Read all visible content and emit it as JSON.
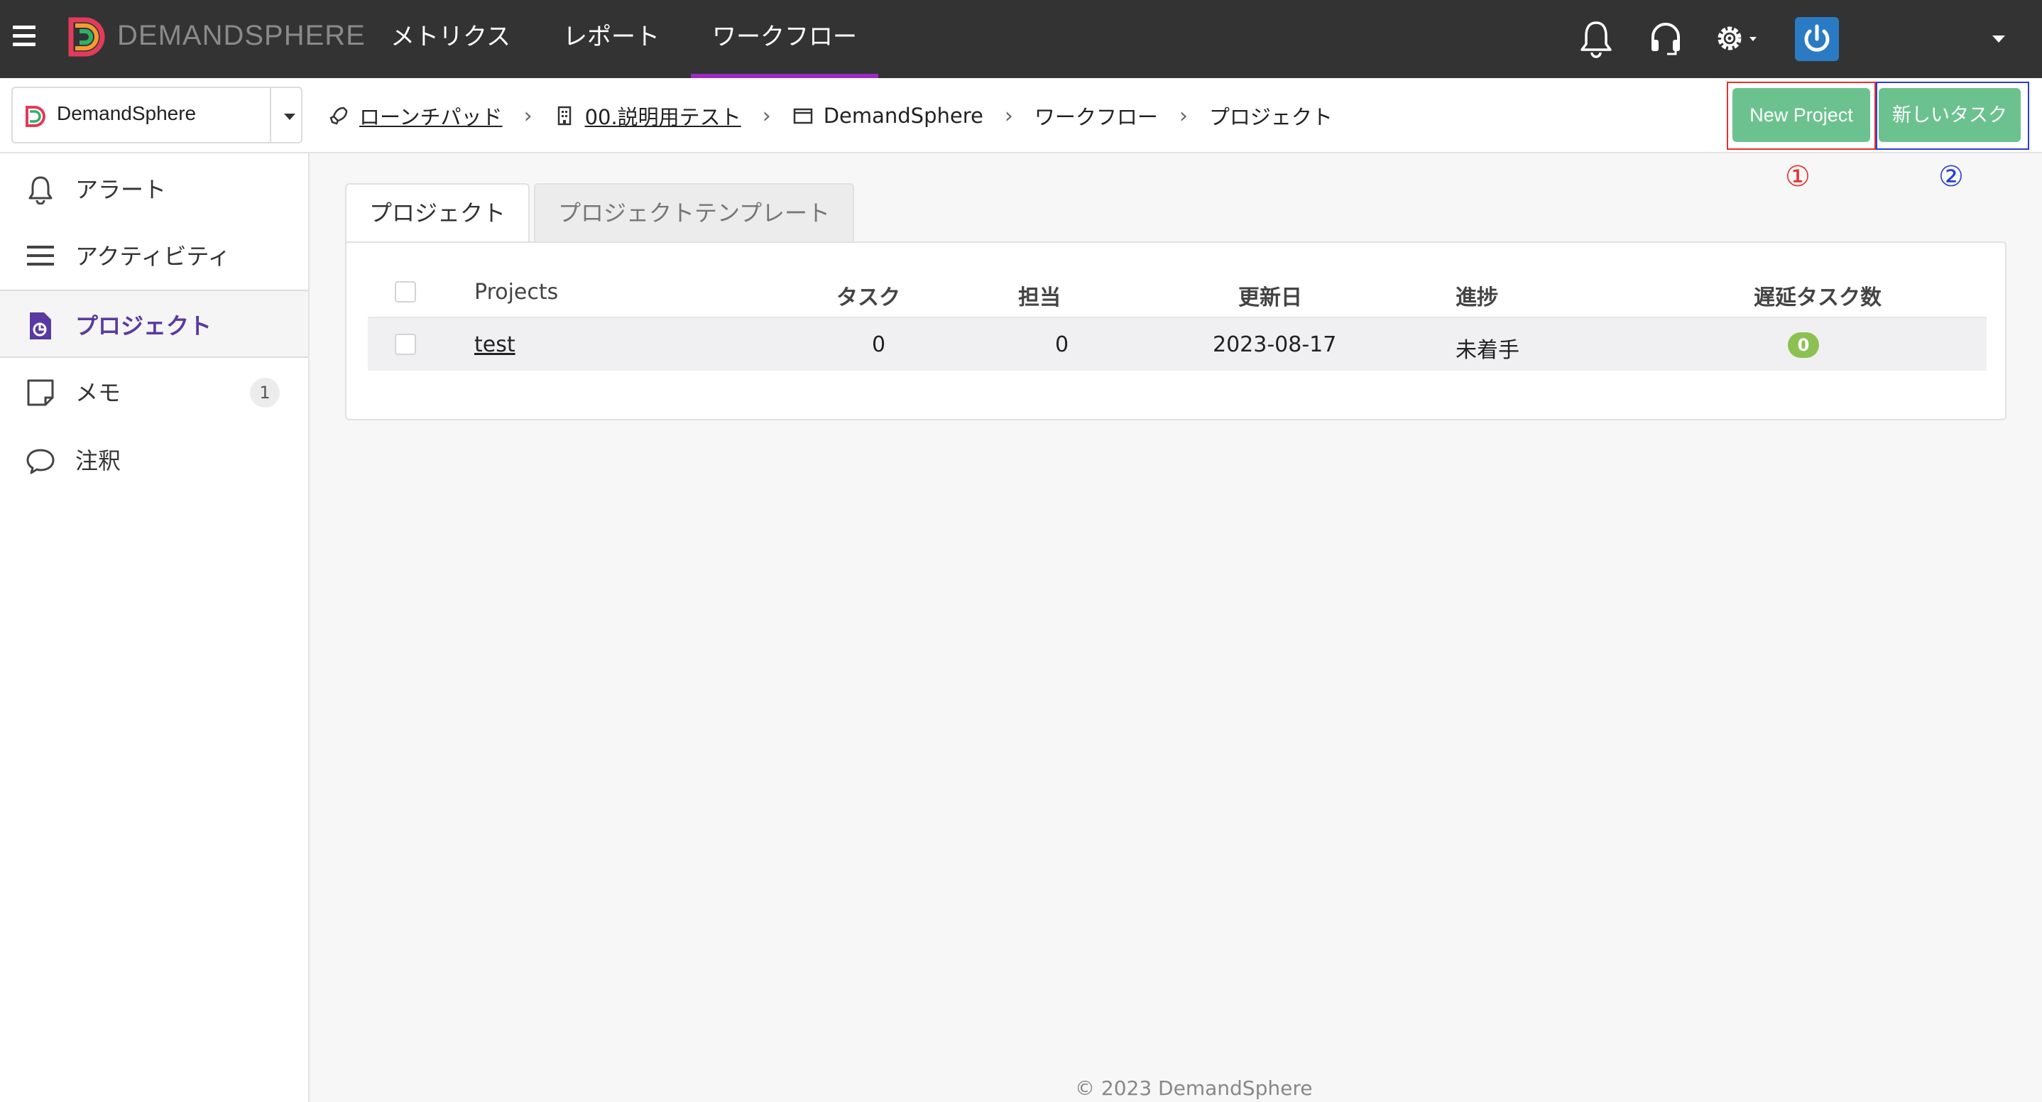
{
  "header": {
    "brand": "DEMANDSPHERE",
    "nav": [
      {
        "label": "メトリクス"
      },
      {
        "label": "レポート"
      },
      {
        "label": "ワークフロー",
        "active": true
      }
    ],
    "icons": [
      "menu-icon",
      "bell-icon",
      "headset-icon",
      "gear-icon",
      "power-icon",
      "chevron-down-icon"
    ]
  },
  "site_selector": {
    "name": "DemandSphere"
  },
  "breadcrumb": [
    {
      "label": "ローンチパッド",
      "icon": "rocket-icon",
      "link": true
    },
    {
      "label": "00.説明用テスト",
      "icon": "building-icon",
      "link": true
    },
    {
      "label": "DemandSphere",
      "icon": "window-icon",
      "link": false
    },
    {
      "label": "ワークフロー",
      "link": false
    },
    {
      "label": "プロジェクト",
      "link": false
    }
  ],
  "actions": {
    "new_project": "New Project",
    "new_task": "新しいタスク",
    "marker_1": "①",
    "marker_2": "②",
    "button_color": "#6cc28f"
  },
  "sidebar": {
    "items": [
      {
        "label": "アラート",
        "icon": "bell-icon"
      },
      {
        "label": "アクティビティ",
        "icon": "list-icon"
      },
      {
        "label": "プロジェクト",
        "icon": "project-file-icon",
        "active": true
      },
      {
        "label": "メモ",
        "icon": "note-icon",
        "badge": "1"
      },
      {
        "label": "注釈",
        "icon": "comment-icon"
      }
    ]
  },
  "tabs": [
    {
      "label": "プロジェクト",
      "active": true
    },
    {
      "label": "プロジェクトテンプレート",
      "active": false
    }
  ],
  "table": {
    "columns": [
      "Projects",
      "タスク",
      "担当",
      "更新日",
      "進捗",
      "遅延タスク数"
    ],
    "rows": [
      {
        "project": "test",
        "tasks": "0",
        "assigned": "0",
        "updated": "2023-08-17",
        "progress": "未着手",
        "delayed": "0"
      }
    ]
  },
  "footer": "© 2023 DemandSphere"
}
